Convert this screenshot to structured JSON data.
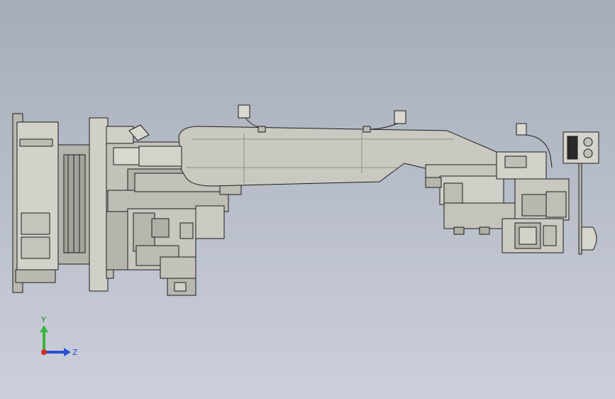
{
  "triad": {
    "y_label": "Y",
    "z_label": "Z"
  },
  "colors": {
    "background_top": "#a5adb8",
    "background_bottom": "#cbcfd9",
    "body": "#c9c9c1",
    "body_light": "#d6d6cf",
    "body_dark": "#a8a8a0",
    "outline": "#1c1c1c",
    "triad_y": "#3ab43a",
    "triad_z": "#2a4fd6",
    "triad_origin": "#d42a2a"
  },
  "icons": [
    "robot-arm-model",
    "coordinate-triad-icon"
  ]
}
